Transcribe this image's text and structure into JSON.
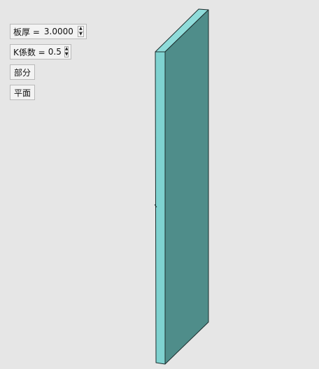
{
  "controls": {
    "thickness": {
      "label": "板厚 =",
      "value": "3.0000"
    },
    "kfactor": {
      "label": "K係数 =",
      "value": "0.5"
    }
  },
  "buttons": {
    "partial_label": "部分",
    "flat_label": "平面"
  },
  "model": {
    "front_color": "#4f8d8a",
    "side_color": "#7fd2d0",
    "top_color": "#8fdcda",
    "edge_color": "#1c2d2d"
  },
  "background_color": "#e6e6e6"
}
